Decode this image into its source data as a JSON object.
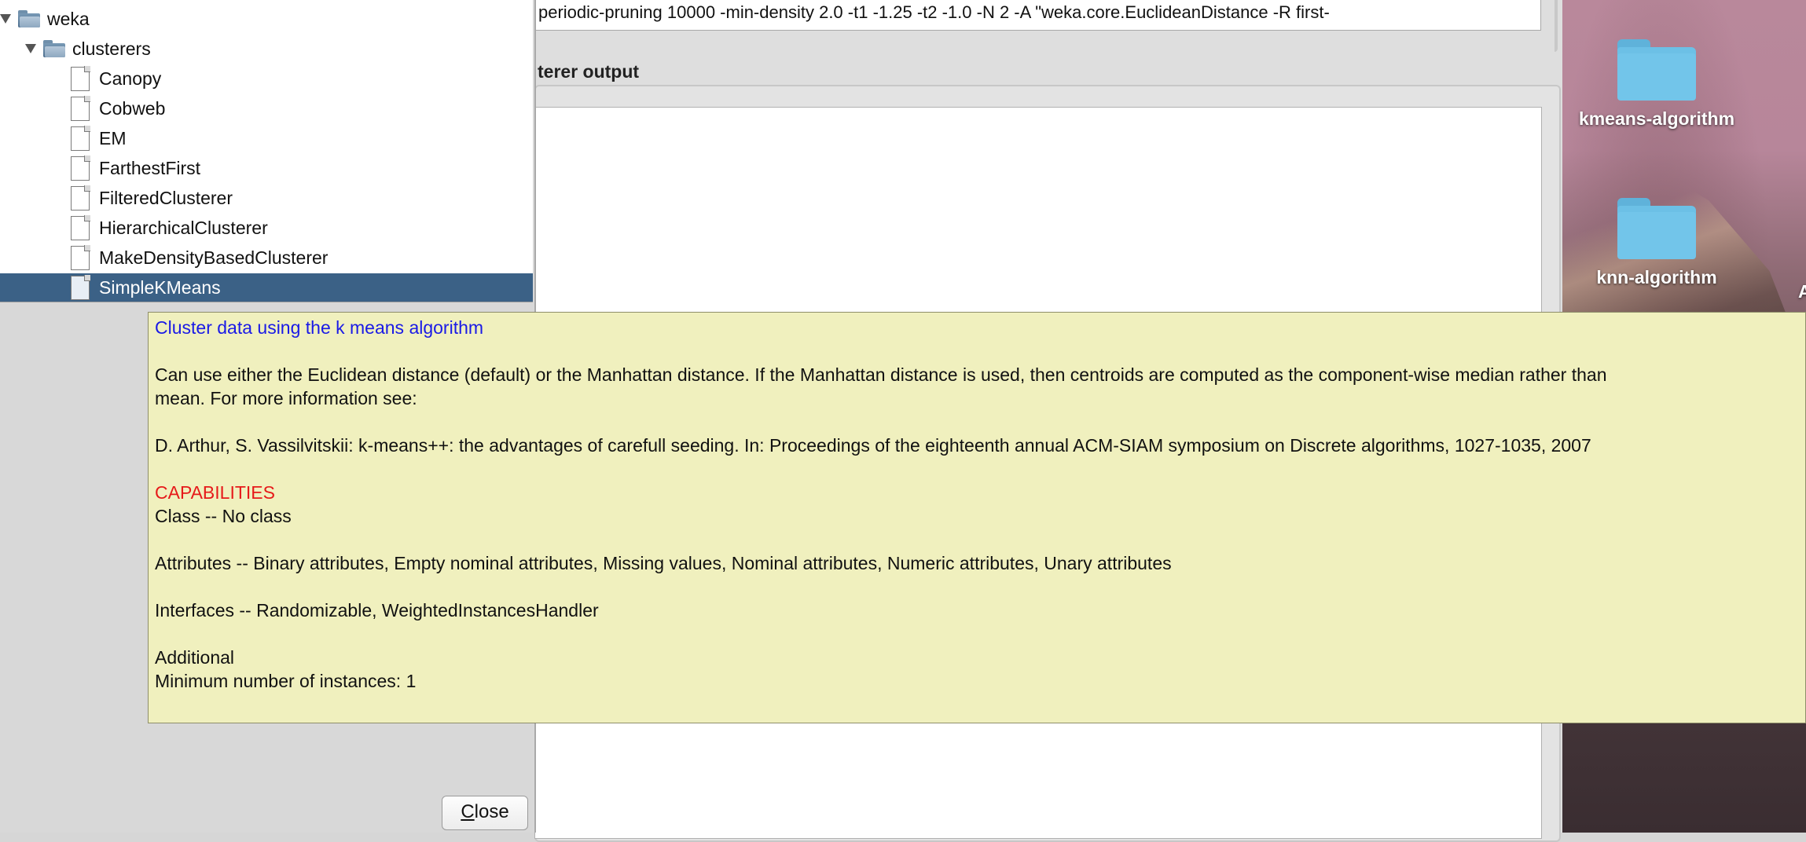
{
  "options_field": {
    "text": "periodic-pruning 10000 -min-density 2.0 -t1 -1.25 -t2 -1.0 -N 2 -A \"weka.core.EuclideanDistance -R first-"
  },
  "output_panel": {
    "title": "terer output"
  },
  "tree": {
    "root": "weka",
    "folder": "clusterers",
    "items": [
      "Canopy",
      "Cobweb",
      "EM",
      "FarthestFirst",
      "FilteredClusterer",
      "HierarchicalClusterer",
      "MakeDensityBasedClusterer",
      "SimpleKMeans"
    ],
    "selected": "SimpleKMeans"
  },
  "close_button": {
    "label_underlined": "C",
    "label_rest": "lose"
  },
  "tooltip": {
    "heading": "Cluster data using the k means algorithm",
    "description_line1": "Can use either the Euclidean distance (default) or the Manhattan distance. If the Manhattan distance is used, then centroids are computed as the component-wise median rather than",
    "description_line2": "mean. For more information see:",
    "reference": "D. Arthur, S. Vassilvitskii: k-means++: the advantages of carefull seeding. In: Proceedings of the eighteenth annual ACM-SIAM symposium on Discrete algorithms, 1027-1035, 2007",
    "capabilities_heading": "CAPABILITIES",
    "class_line": "Class -- No class",
    "attributes_line": "Attributes -- Binary attributes, Empty nominal attributes, Missing values, Nominal attributes, Numeric attributes, Unary attributes",
    "interfaces_line": "Interfaces -- Randomizable, WeightedInstancesHandler",
    "additional_heading": "Additional",
    "min_instances_line": "Minimum number of instances: 1"
  },
  "desktop": {
    "folders": [
      "kmeans-algorithm",
      "knn-algorithm"
    ],
    "partial_label": "A"
  },
  "colors": {
    "tooltip_bg": "#f0f0be",
    "selection": "#3b6186",
    "heading_blue": "#1a1ae6",
    "capabilities_red": "#e61a1a",
    "folder_blue": "#6cc0e6"
  }
}
